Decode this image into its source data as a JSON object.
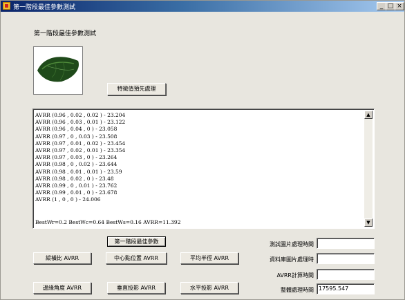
{
  "window": {
    "title": "第一階段最佳參數測試"
  },
  "titlebar_buttons": {
    "minimize": "_",
    "maximize": "□",
    "close": "×"
  },
  "form": {
    "label": "第一階段最佳參數測試"
  },
  "picture": {
    "icon": "leaf-image"
  },
  "buttons": {
    "preprocess": "特徵值預先處理",
    "stage1_best": "第一階段最佳參數",
    "aspect_ratio": "縱橫比 AVRR",
    "centroid": "中心點位置 AVRR",
    "mean_radius": "平均半徑 AVRR",
    "edge_angle": "邊緣角度 AVRR",
    "vertical_proj": "垂直投影 AVRR",
    "horizontal_proj": "水平投影 AVRR"
  },
  "results": {
    "lines": [
      "AVRR (0.96 , 0.02 , 0.02 ) - 23.204",
      "AVRR (0.96 , 0.03 , 0.01 ) - 23.122",
      "AVRR (0.96 , 0.04 , 0 ) - 23.058",
      "AVRR (0.97 , 0 , 0.03 ) - 23.508",
      "AVRR (0.97 , 0.01 , 0.02 ) - 23.454",
      "AVRR (0.97 , 0.02 , 0.01 ) - 23.354",
      "AVRR (0.97 , 0.03 , 0 ) - 23.264",
      "AVRR (0.98 , 0 , 0.02 ) - 23.644",
      "AVRR (0.98 , 0.01 , 0.01 ) - 23.59",
      "AVRR (0.98 , 0.02 , 0 ) - 23.48",
      "AVRR (0.99 , 0 , 0.01 ) - 23.762",
      "AVRR (0.99 , 0.01 , 0 ) - 23.678",
      "AVRR (1 , 0 , 0 ) - 24.006"
    ],
    "summary": "BestWr=0.2  BestWc=0.64  BestWs=0.16  AVRR=11.392",
    "scroll_up": "▲",
    "scroll_down": "▼"
  },
  "timings": {
    "test_image_label": "測試圖片處理時間",
    "db_image_label": "資料庫圖片處理時",
    "avrr_label": "AVRR計算時間",
    "total_label": "整體處理時間",
    "test_image_value": "",
    "db_image_value": "",
    "avrr_value": "",
    "total_value": "17595.547"
  }
}
